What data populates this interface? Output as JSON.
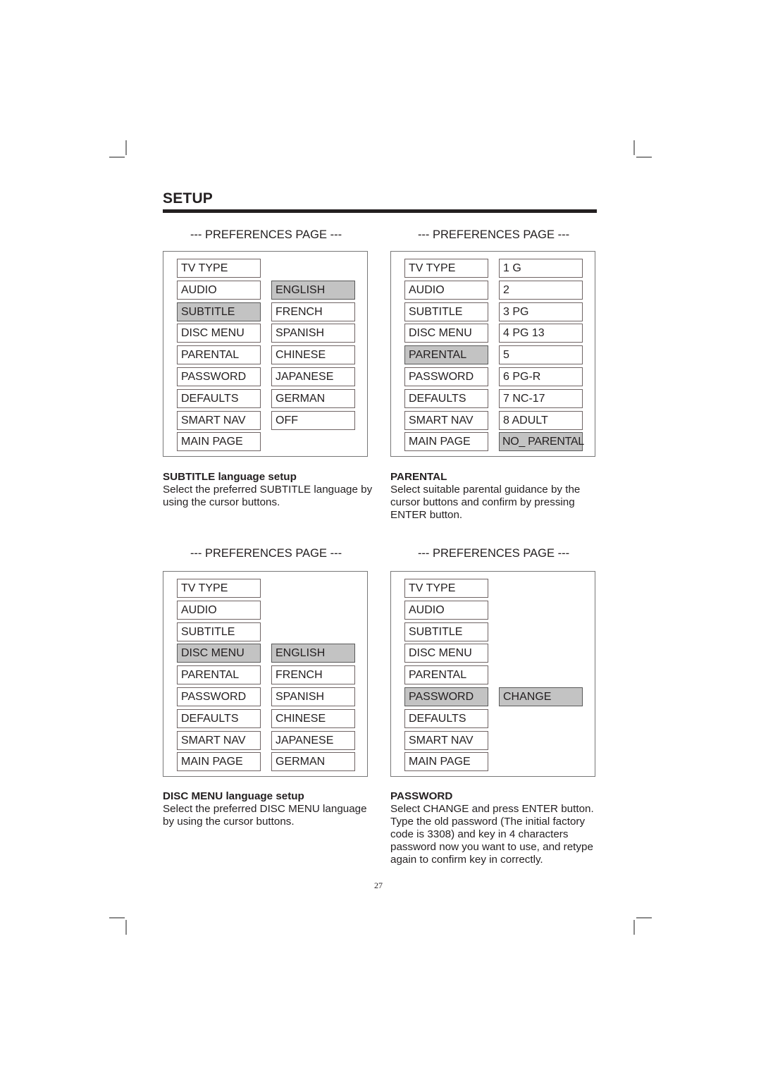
{
  "page": {
    "title": "SETUP",
    "page_number": "27"
  },
  "panels": [
    {
      "heading": "--- PREFERENCES PAGE ---",
      "menu": [
        {
          "label": "TV TYPE",
          "selected": false
        },
        {
          "label": "AUDIO",
          "selected": false
        },
        {
          "label": "SUBTITLE",
          "selected": true
        },
        {
          "label": "DISC MENU",
          "selected": false
        },
        {
          "label": "PARENTAL",
          "selected": false
        },
        {
          "label": "PASSWORD",
          "selected": false
        },
        {
          "label": "DEFAULTS",
          "selected": false
        },
        {
          "label": "SMART NAV",
          "selected": false
        },
        {
          "label": "MAIN PAGE",
          "selected": false
        }
      ],
      "options_start_row": 1,
      "options": [
        {
          "label": "ENGLISH",
          "selected": true
        },
        {
          "label": "FRENCH",
          "selected": false
        },
        {
          "label": "SPANISH",
          "selected": false
        },
        {
          "label": "CHINESE",
          "selected": false
        },
        {
          "label": "JAPANESE",
          "selected": false
        },
        {
          "label": "GERMAN",
          "selected": false
        },
        {
          "label": "OFF",
          "selected": false
        }
      ],
      "description": {
        "title": "SUBTITLE language setup",
        "body": "Select the preferred SUBTITLE language by using the cursor buttons."
      }
    },
    {
      "heading": "--- PREFERENCES PAGE ---",
      "menu": [
        {
          "label": "TV TYPE",
          "selected": false
        },
        {
          "label": "AUDIO",
          "selected": false
        },
        {
          "label": "SUBTITLE",
          "selected": false
        },
        {
          "label": "DISC MENU",
          "selected": false
        },
        {
          "label": "PARENTAL",
          "selected": true
        },
        {
          "label": "PASSWORD",
          "selected": false
        },
        {
          "label": "DEFAULTS",
          "selected": false
        },
        {
          "label": "SMART NAV",
          "selected": false
        },
        {
          "label": "MAIN PAGE",
          "selected": false
        }
      ],
      "options_start_row": 0,
      "options": [
        {
          "label": "1 G",
          "selected": false
        },
        {
          "label": "2",
          "selected": false
        },
        {
          "label": "3 PG",
          "selected": false
        },
        {
          "label": "4 PG 13",
          "selected": false
        },
        {
          "label": "5",
          "selected": false
        },
        {
          "label": "6 PG-R",
          "selected": false
        },
        {
          "label": "7 NC-17",
          "selected": false
        },
        {
          "label": "8 ADULT",
          "selected": false
        },
        {
          "label": "NO_ PARENTAL",
          "selected": true
        }
      ],
      "description": {
        "title": "PARENTAL",
        "body": "Select suitable parental guidance by the cursor buttons and confirm by pressing ENTER button."
      }
    },
    {
      "heading": "--- PREFERENCES PAGE ---",
      "menu": [
        {
          "label": "TV TYPE",
          "selected": false
        },
        {
          "label": "AUDIO",
          "selected": false
        },
        {
          "label": "SUBTITLE",
          "selected": false
        },
        {
          "label": "DISC MENU",
          "selected": true
        },
        {
          "label": "PARENTAL",
          "selected": false
        },
        {
          "label": "PASSWORD",
          "selected": false
        },
        {
          "label": "DEFAULTS",
          "selected": false
        },
        {
          "label": "SMART NAV",
          "selected": false
        },
        {
          "label": "MAIN PAGE",
          "selected": false
        }
      ],
      "options_start_row": 3,
      "options": [
        {
          "label": "ENGLISH",
          "selected": true
        },
        {
          "label": "FRENCH",
          "selected": false
        },
        {
          "label": "SPANISH",
          "selected": false
        },
        {
          "label": "CHINESE",
          "selected": false
        },
        {
          "label": "JAPANESE",
          "selected": false
        },
        {
          "label": "GERMAN",
          "selected": false
        }
      ],
      "description": {
        "title": "DISC MENU language setup",
        "body": "Select the preferred DISC MENU language by using the cursor buttons."
      }
    },
    {
      "heading": "--- PREFERENCES PAGE ---",
      "menu": [
        {
          "label": "TV TYPE",
          "selected": false
        },
        {
          "label": "AUDIO",
          "selected": false
        },
        {
          "label": "SUBTITLE",
          "selected": false
        },
        {
          "label": "DISC MENU",
          "selected": false
        },
        {
          "label": "PARENTAL",
          "selected": false
        },
        {
          "label": "PASSWORD",
          "selected": true
        },
        {
          "label": "DEFAULTS",
          "selected": false
        },
        {
          "label": "SMART NAV",
          "selected": false
        },
        {
          "label": "MAIN PAGE",
          "selected": false
        }
      ],
      "options_start_row": 5,
      "options": [
        {
          "label": "CHANGE",
          "selected": true
        }
      ],
      "description": {
        "title": "PASSWORD",
        "body": "Select CHANGE and press ENTER button.  Type the old password (The initial factory code is 3308) and key in 4 characters password now you want to use, and retype again to confirm key in correctly."
      }
    }
  ]
}
